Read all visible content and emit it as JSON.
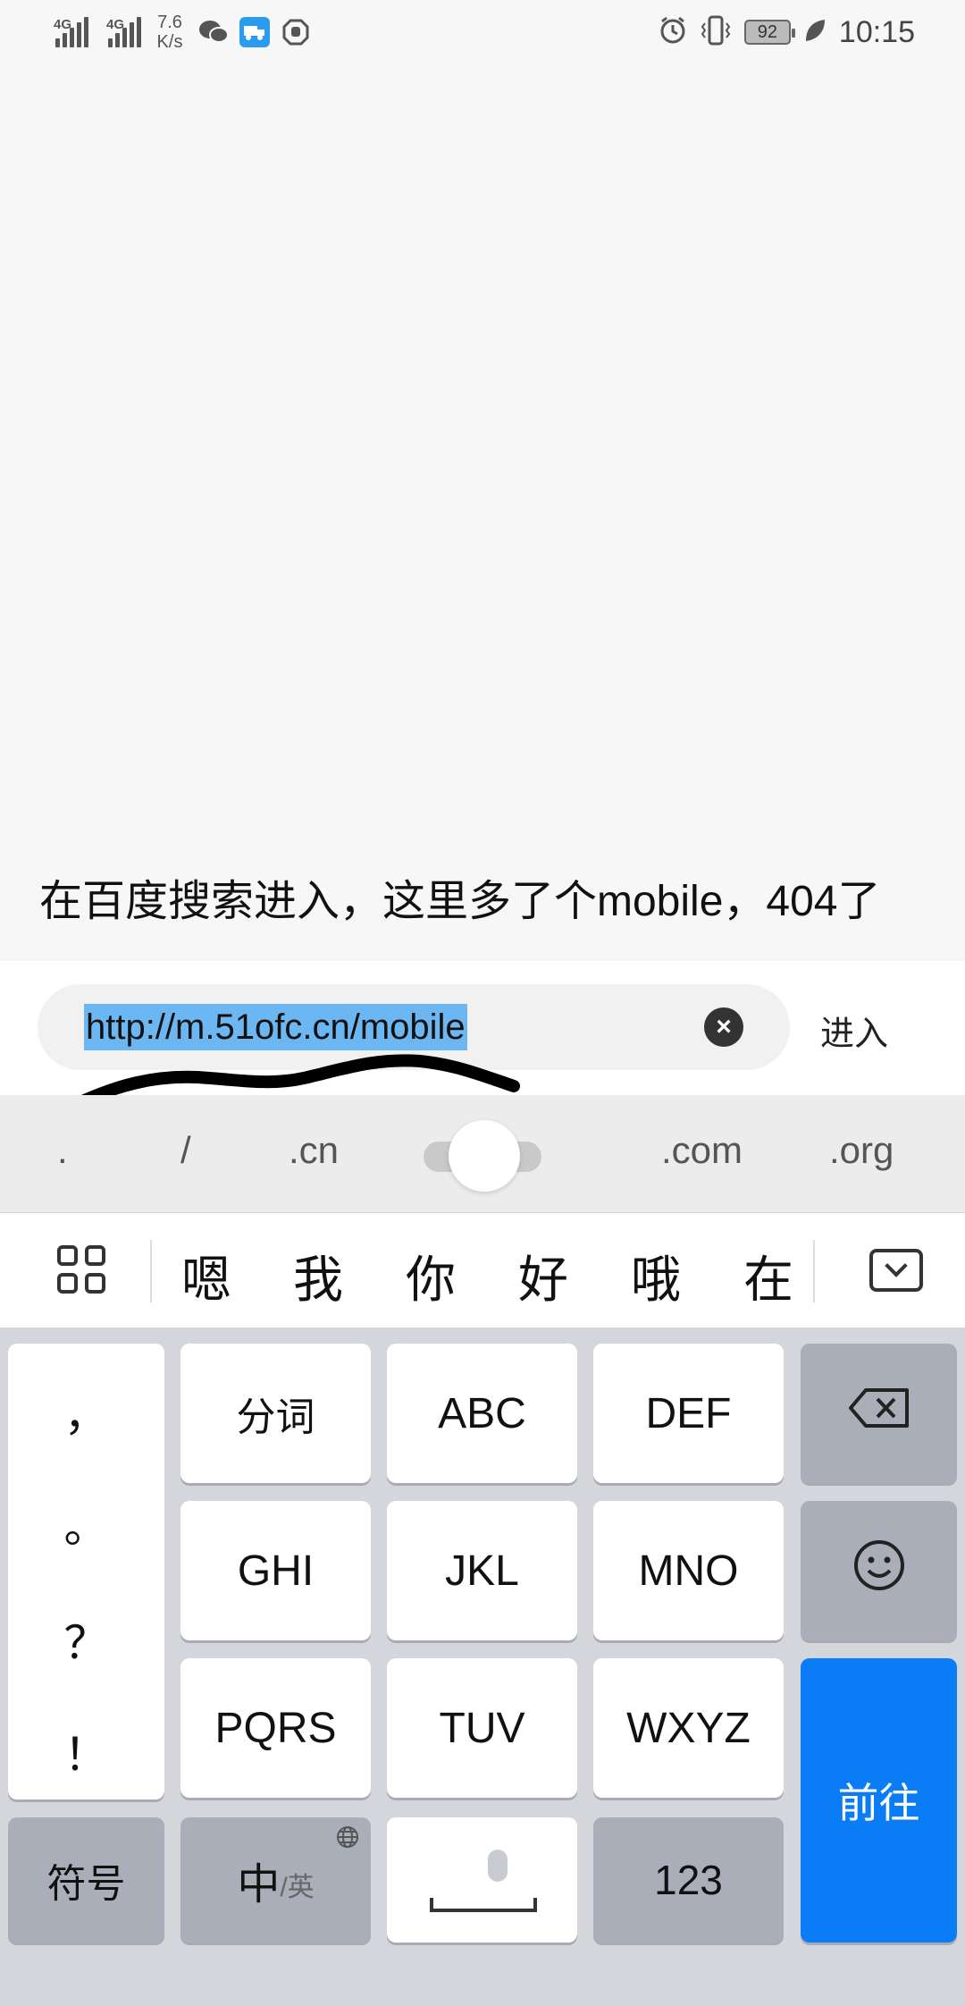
{
  "status_bar": {
    "network_1": "4G",
    "network_2": "4G",
    "speed_value": "7.6",
    "speed_unit": "K/s",
    "battery": "92",
    "time": "10:15"
  },
  "annotation": "在百度搜索进入，这里多了个mobile，404了",
  "url_bar": {
    "url": "http://m.51ofc.cn/mobile",
    "enter_label": "进入"
  },
  "quick_input": [
    ".",
    "/",
    ".cn",
    ".com",
    ".org"
  ],
  "candidates": [
    "嗯",
    "我",
    "你",
    "好",
    "哦",
    "在"
  ],
  "keyboard": {
    "punctuation": [
      "，",
      "。",
      "？",
      "！"
    ],
    "keys": {
      "fenci": "分词",
      "abc": "ABC",
      "def": "DEF",
      "ghi": "GHI",
      "jkl": "JKL",
      "mno": "MNO",
      "pqrs": "PQRS",
      "tuv": "TUV",
      "wxyz": "WXYZ",
      "symbols": "符号",
      "zh": "中",
      "zh_sub": "/英",
      "num": "123",
      "go": "前往"
    }
  },
  "colors": {
    "go_key": "#0a7cf5",
    "url_highlight": "#6cb7f2"
  }
}
